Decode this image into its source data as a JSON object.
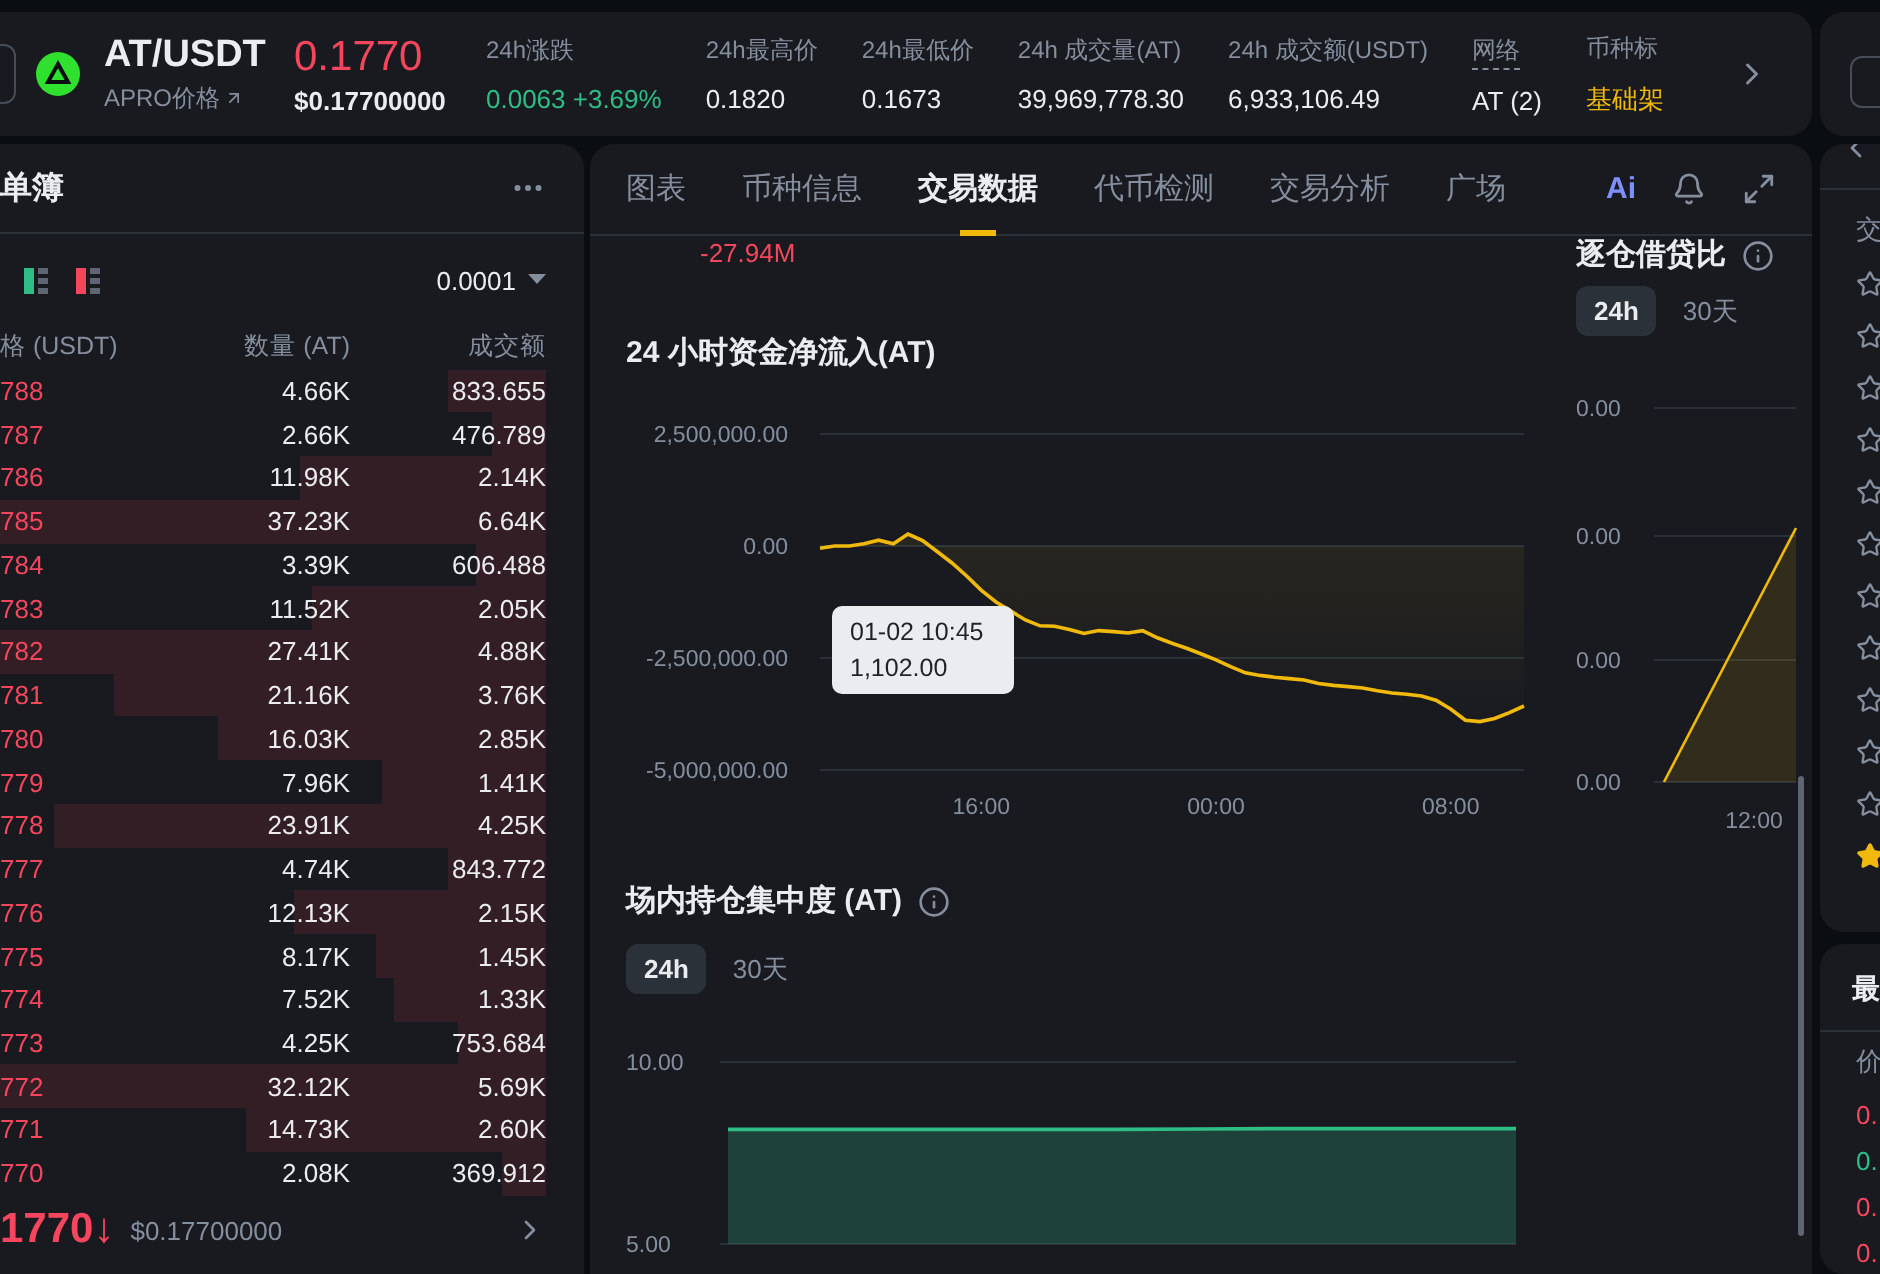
{
  "header": {
    "pair": "AT/USDT",
    "subtitle": "APRO价格",
    "price": "0.1770",
    "price_usd": "$0.17700000",
    "stats": [
      {
        "label": "24h涨跌",
        "value": "0.0063 +3.69%",
        "color": "#2ebd85",
        "dotted": false
      },
      {
        "label": "24h最高价",
        "value": "0.1820",
        "color": "#eaecef",
        "dotted": false
      },
      {
        "label": "24h最低价",
        "value": "0.1673",
        "color": "#eaecef",
        "dotted": false
      },
      {
        "label": "24h 成交量(AT)",
        "value": "39,969,778.30",
        "color": "#eaecef",
        "dotted": false
      },
      {
        "label": "24h 成交额(USDT)",
        "value": "6,933,106.49",
        "color": "#eaecef",
        "dotted": false
      },
      {
        "label": "网络",
        "value": "AT (2)",
        "color": "#eaecef",
        "dotted": true
      },
      {
        "label": "币种标",
        "value": "基础架",
        "color": "#f0b90b",
        "dotted": false
      }
    ]
  },
  "order_book": {
    "title": "单簿",
    "precision": "0.0001",
    "columns": [
      "格 (USDT)",
      "数量 (AT)",
      "成交额"
    ],
    "rows": [
      {
        "price": "788",
        "amount": "4.66K",
        "total": "833.655",
        "level": 0.18
      },
      {
        "price": "787",
        "amount": "2.66K",
        "total": "476.789",
        "level": 0.1
      },
      {
        "price": "786",
        "amount": "11.98K",
        "total": "2.14K",
        "level": 0.45
      },
      {
        "price": "785",
        "amount": "37.23K",
        "total": "6.64K",
        "level": 1
      },
      {
        "price": "784",
        "amount": "3.39K",
        "total": "606.488",
        "level": 0.13
      },
      {
        "price": "783",
        "amount": "11.52K",
        "total": "2.05K",
        "level": 0.43
      },
      {
        "price": "782",
        "amount": "27.41K",
        "total": "4.88K",
        "level": 1
      },
      {
        "price": "781",
        "amount": "21.16K",
        "total": "3.76K",
        "level": 0.79
      },
      {
        "price": "780",
        "amount": "16.03K",
        "total": "2.85K",
        "level": 0.6
      },
      {
        "price": "779",
        "amount": "7.96K",
        "total": "1.41K",
        "level": 0.3
      },
      {
        "price": "778",
        "amount": "23.91K",
        "total": "4.25K",
        "level": 0.9
      },
      {
        "price": "777",
        "amount": "4.74K",
        "total": "843.772",
        "level": 0.18
      },
      {
        "price": "776",
        "amount": "12.13K",
        "total": "2.15K",
        "level": 0.46
      },
      {
        "price": "775",
        "amount": "8.17K",
        "total": "1.45K",
        "level": 0.31
      },
      {
        "price": "774",
        "amount": "7.52K",
        "total": "1.33K",
        "level": 0.28
      },
      {
        "price": "773",
        "amount": "4.25K",
        "total": "753.684",
        "level": 0.16
      },
      {
        "price": "772",
        "amount": "32.12K",
        "total": "5.69K",
        "level": 1
      },
      {
        "price": "771",
        "amount": "14.73K",
        "total": "2.60K",
        "level": 0.55
      },
      {
        "price": "770",
        "amount": "2.08K",
        "total": "369.912",
        "level": 0.08
      }
    ],
    "last_price": "1770",
    "arrow": "↓",
    "last_price_usd": "$0.17700000"
  },
  "tabs": [
    {
      "label": "图表",
      "selected": false
    },
    {
      "label": "币种信息",
      "selected": false
    },
    {
      "label": "交易数据",
      "selected": true
    },
    {
      "label": "代币检测",
      "selected": false
    },
    {
      "label": "交易分析",
      "selected": false
    },
    {
      "label": "广场",
      "selected": false
    }
  ],
  "ai_label": "Ai",
  "inflow": {
    "prev_value": "-27.94M",
    "title": "24 小时资金净流入(AT)",
    "tooltip": {
      "time": "01-02 10:45",
      "value": "1,102.00"
    },
    "chart_data": {
      "type": "area",
      "categories": [
        null,
        null,
        null,
        null,
        null,
        null,
        null,
        null,
        null,
        null,
        null,
        "16:00",
        null,
        null,
        null,
        null,
        null,
        null,
        null,
        null,
        null,
        null,
        null,
        null,
        null,
        null,
        null,
        "00:00",
        null,
        null,
        null,
        null,
        null,
        null,
        null,
        null,
        null,
        null,
        null,
        null,
        null,
        null,
        null,
        "08:00",
        null,
        null,
        null,
        null,
        null
      ],
      "series": [
        {
          "color": "#f0b90b",
          "values": [
            -50000,
            0,
            0,
            50000,
            130000,
            50000,
            270000,
            120000,
            -130000,
            -380000,
            -670000,
            -990000,
            -1250000,
            null,
            -1650000,
            -1780000,
            -1790000,
            -1860000,
            -1950000,
            -1890000,
            -1910000,
            -1940000,
            -1890000,
            -2050000,
            -2170000,
            -2280000,
            -2410000,
            -2540000,
            -2690000,
            -2830000,
            -2890000,
            -2930000,
            -2960000,
            -2990000,
            -3070000,
            -3110000,
            -3140000,
            -3170000,
            -3230000,
            -3280000,
            -3310000,
            -3350000,
            -3440000,
            -3640000,
            -3890000,
            -3920000,
            -3850000,
            -3720000,
            -3570000
          ]
        }
      ],
      "ylim": [
        -5000000,
        2500000
      ],
      "yticks": [
        {
          "value": 2500000,
          "label": "2,500,000.00"
        },
        {
          "value": 0,
          "label": "0.00"
        },
        {
          "value": -2500000,
          "label": "-2,500,000.00"
        },
        {
          "value": -5000000,
          "label": "-5,000,000.00"
        }
      ]
    }
  },
  "concentration": {
    "title": "场内持仓集中度 (AT)",
    "ranges": [
      {
        "label": "24h",
        "selected": true
      },
      {
        "label": "30天",
        "selected": false
      }
    ],
    "chart_data": {
      "type": "area",
      "categories": [
        null,
        null,
        null,
        null,
        null,
        null,
        null,
        null,
        null,
        null,
        null
      ],
      "series": [
        {
          "color": "#2ebd85",
          "values": [
            8.15,
            8.15,
            8.15,
            8.15,
            8.15,
            8.15,
            8.16,
            8.17,
            8.17,
            8.17,
            8.17
          ]
        }
      ],
      "ylim": [
        5,
        10
      ],
      "yticks": [
        {
          "value": 10,
          "label": "10.00"
        },
        {
          "value": 5,
          "label": "5.00"
        }
      ]
    }
  },
  "margin_ratio": {
    "title": "逐仓借贷比",
    "ranges": [
      {
        "label": "24h",
        "selected": true
      },
      {
        "label": "30天",
        "selected": false
      }
    ],
    "y_labels": [
      "0.00",
      "0.00",
      "0.00",
      "0.00"
    ],
    "x_labels": [
      "12:00"
    ]
  },
  "side_panel": {
    "header": "交",
    "favorites": [
      {
        "starred": false
      },
      {
        "starred": false
      },
      {
        "starred": false
      },
      {
        "starred": false
      },
      {
        "starred": false
      },
      {
        "starred": false
      },
      {
        "starred": false
      },
      {
        "starred": false
      },
      {
        "starred": false
      },
      {
        "starred": false
      },
      {
        "starred": false
      },
      {
        "starred": true
      }
    ]
  },
  "recent": {
    "header": "最",
    "column": "价",
    "prices": [
      {
        "text": "0.",
        "color": "#f6465d"
      },
      {
        "text": "0.",
        "color": "#2ebd85"
      },
      {
        "text": "0.",
        "color": "#f6465d"
      },
      {
        "text": "0.",
        "color": "#f6465d"
      }
    ]
  }
}
